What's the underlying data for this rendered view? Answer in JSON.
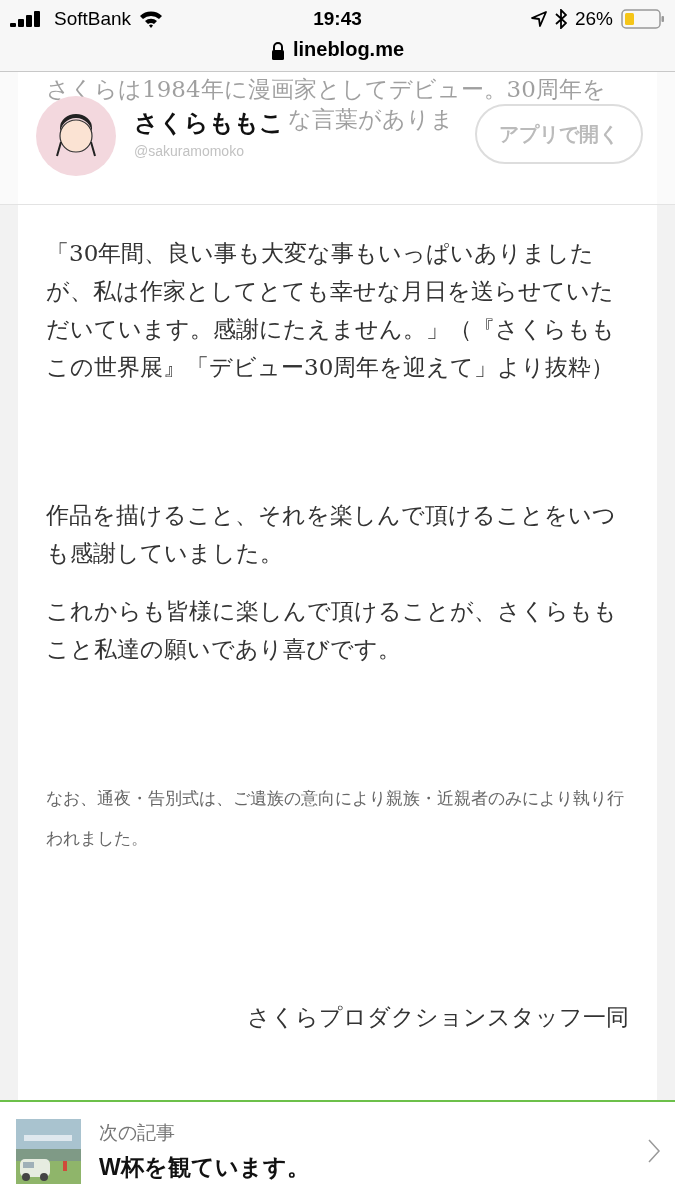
{
  "status_bar": {
    "carrier": "SoftBank",
    "time": "19:43",
    "battery": "26%"
  },
  "address_bar": {
    "url": "lineblog.me"
  },
  "behind_header": [
    "さくらは1984年に漫画家としてデビュー。30周年を",
    "な言葉がありま"
  ],
  "header": {
    "name": "さくらももこ",
    "handle": "@sakuramomoko",
    "open_button": "アプリで開く"
  },
  "article": {
    "paragraphs": [
      {
        "kind": "body",
        "text": "「30年間、良い事も大変な事もいっぱいありましたが、私は作家としてとても幸せな月日を送らせていただいています。感謝にたえません。」（『さくらももこの世界展』「デビュー30周年を迎えて」より抜粋）"
      },
      {
        "kind": "gap"
      },
      {
        "kind": "body",
        "text": "作品を描けること、それを楽しんで頂けることをいつも感謝していました。"
      },
      {
        "kind": "body",
        "text": "これからも皆様に楽しんで頂けることが、さくらももこと私達の願いであり喜びです。"
      },
      {
        "kind": "gap"
      },
      {
        "kind": "note",
        "text": "なお、通夜・告別式は、ご遺族の意向により親族・近親者のみにより執り行われました。"
      },
      {
        "kind": "biggap"
      },
      {
        "kind": "signature",
        "text": "さくらプロダクションスタッフ一同"
      }
    ]
  },
  "next_article": {
    "label": "次の記事",
    "title": "W杯を観ています。"
  }
}
